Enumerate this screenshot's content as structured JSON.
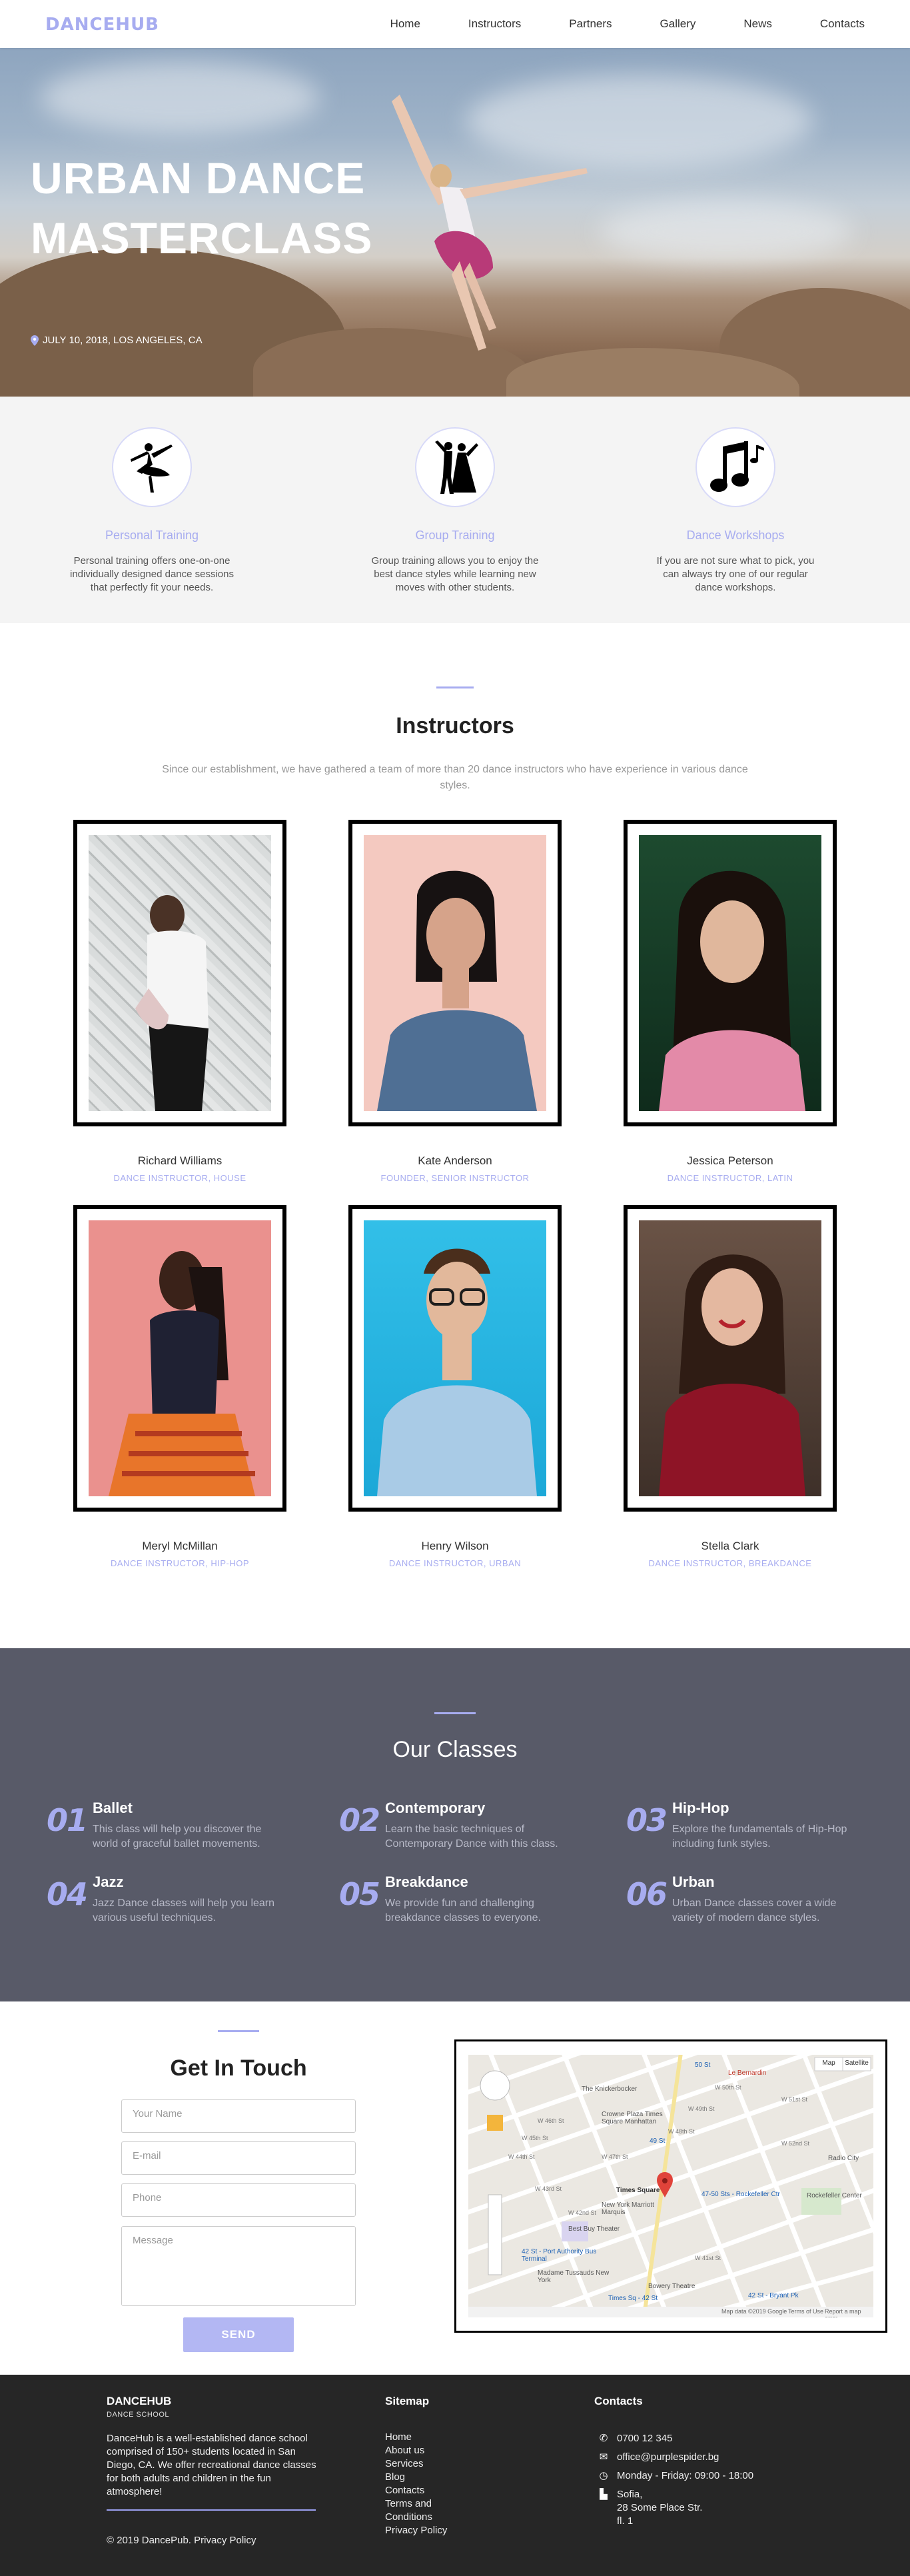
{
  "nav": {
    "logo": "DANCEHUB",
    "links": [
      "Home",
      "Instructors",
      "Partners",
      "Gallery",
      "News",
      "Contacts"
    ]
  },
  "hero": {
    "title_line1": "URBAN DANCE",
    "title_line2": "MASTERCLASS",
    "meta": "JULY 10, 2018, LOS ANGELES, CA"
  },
  "features": [
    {
      "title": "Personal Training",
      "text": "Personal training offers one-on-one individually designed dance sessions that perfectly fit your needs."
    },
    {
      "title": "Group Training",
      "text": "Group training allows you to enjoy the best dance styles while learning new moves with other students."
    },
    {
      "title": "Dance Workshops",
      "text": "If you are not sure what to pick, you can always try one of our regular dance workshops."
    }
  ],
  "instructors": {
    "title": "Instructors",
    "subtitle": "Since our establishment, we have gathered a team of more than 20 dance instructors who have experience in various dance styles.",
    "people": [
      {
        "name": "Richard Williams",
        "role": "DANCE INSTRUCTOR, HOUSE"
      },
      {
        "name": "Kate Anderson",
        "role": "FOUNDER, SENIOR INSTRUCTOR"
      },
      {
        "name": "Jessica Peterson",
        "role": "DANCE INSTRUCTOR, LATIN"
      },
      {
        "name": "Meryl McMillan",
        "role": "DANCE INSTRUCTOR, HIP-HOP"
      },
      {
        "name": "Henry Wilson",
        "role": "DANCE INSTRUCTOR, URBAN"
      },
      {
        "name": "Stella Clark",
        "role": "DANCE INSTRUCTOR, BREAKDANCE"
      }
    ]
  },
  "classes": {
    "title": "Our Classes",
    "items": [
      {
        "num": "01",
        "title": "Ballet",
        "text": "This class will help you discover the world of graceful ballet movements."
      },
      {
        "num": "02",
        "title": "Contemporary",
        "text": "Learn the basic techniques of Contemporary Dance with this class."
      },
      {
        "num": "03",
        "title": "Hip-Hop",
        "text": "Explore the fundamentals of Hip-Hop including funk styles."
      },
      {
        "num": "04",
        "title": "Jazz",
        "text": "Jazz Dance classes will help you learn various useful techniques."
      },
      {
        "num": "05",
        "title": "Breakdance",
        "text": "We provide fun and challenging breakdance classes to everyone."
      },
      {
        "num": "06",
        "title": "Urban",
        "text": "Urban Dance classes cover a wide variety of modern dance styles."
      }
    ]
  },
  "contact": {
    "title": "Get In Touch",
    "name_placeholder": "Your Name",
    "email_placeholder": "E-mail",
    "phone_placeholder": "Phone",
    "message_placeholder": "Message",
    "send_label": "SEND"
  },
  "map": {
    "map_button": "Map",
    "satellite_button": "Satellite",
    "footer_text": "Map data ©2019 Google",
    "terms": "Terms of Use",
    "report": "Report a map error",
    "labels": [
      "Le Bernardin",
      "The Knickerbocker",
      "Crowne Plaza Times Square Manhattan",
      "Times Square",
      "New York Marriott Marquis",
      "Best Buy Theater",
      "Rockefeller Center",
      "42 St - Port Authority Bus Terminal",
      "Madame Tussauds New York",
      "Bowery Theatre",
      "49 St",
      "47-50 Sts - Rockefeller Ctr",
      "42 St - Bryant Pk",
      "Times Sq - 42 St",
      "W 44th St",
      "W 45th St",
      "W 46th St",
      "W 47th St",
      "W 48th St",
      "W 49th St",
      "W 50th St",
      "W 51st St",
      "W 52nd St",
      "W 43rd St",
      "W 42nd St",
      "W 41st St",
      "50 St",
      "Radio City"
    ]
  },
  "footer": {
    "logo": "DANCEHUB",
    "tagline": "DANCE SCHOOL",
    "about": "DanceHub is a well-established dance school comprised of 150+ students located in San Diego, CA. We offer recreational dance classes for both adults and children in the fun atmosphere!",
    "copyright": "© 2019 DancePub. Privacy Policy",
    "sitemap_title": "Sitemap",
    "sitemap_links": [
      "Home",
      "About us",
      "Services",
      "Blog",
      "Contacts",
      "Terms and",
      "Conditions",
      "Privacy Policy"
    ],
    "contacts_title": "Contacts",
    "phone": "0700 12 345",
    "email": "office@purplespider.bg",
    "hours": "Monday - Friday: 09:00 - 18:00",
    "address_line1": "Sofia,",
    "address_line2": "28 Some Place Str.",
    "address_line3": "fl. 1"
  }
}
